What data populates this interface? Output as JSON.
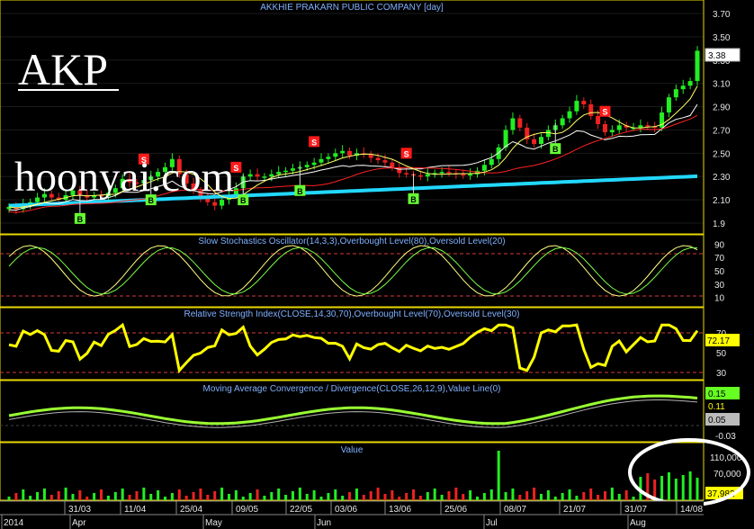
{
  "window": {
    "title": "AKKHIE PRAKARN PUBLIC COMPANY [day]",
    "ticker": "AKP",
    "watermark": "hoonyai.com"
  },
  "colors": {
    "background": "#000000",
    "up_candle": "#22ee22",
    "down_candle": "#ee2222",
    "ma_short": "#ffff66",
    "ma_mid": "#ff2222",
    "ma_long": "#ffffff",
    "ma_longest": "#22d8ff",
    "panel_border": "#e8d800",
    "header_text": "#7fb0ff",
    "sell_box": "#ff1a1a",
    "buy_box": "#66ff33",
    "macd_line": "#99ff33",
    "rsi_line": "#ffff00"
  },
  "chart_data": [
    {
      "type": "candlestick",
      "title": "AKKHIE PRAKARN PUBLIC COMPANY [day]",
      "y_ticks": [
        "3.70",
        "3.50",
        "3.30",
        "3.10",
        "2.90",
        "2.70",
        "2.50",
        "2.30",
        "2.10",
        "1.9"
      ],
      "ylim": [
        1.85,
        3.75
      ],
      "last_value_label": "3.38",
      "close": [
        2.04,
        2.02,
        2.06,
        2.08,
        2.12,
        2.15,
        2.12,
        2.1,
        2.14,
        2.18,
        2.14,
        2.12,
        2.14,
        2.13,
        2.16,
        2.2,
        2.28,
        2.25,
        2.24,
        2.27,
        2.3,
        2.34,
        2.38,
        2.45,
        2.32,
        2.24,
        2.18,
        2.12,
        2.08,
        2.05,
        2.1,
        2.14,
        2.2,
        2.3,
        2.32,
        2.3,
        2.3,
        2.32,
        2.34,
        2.35,
        2.37,
        2.38,
        2.4,
        2.42,
        2.45,
        2.47,
        2.5,
        2.52,
        2.48,
        2.5,
        2.49,
        2.46,
        2.44,
        2.42,
        2.38,
        2.33,
        2.32,
        2.31,
        2.3,
        2.32,
        2.33,
        2.34,
        2.33,
        2.32,
        2.31,
        2.32,
        2.35,
        2.4,
        2.45,
        2.55,
        2.7,
        2.8,
        2.72,
        2.62,
        2.58,
        2.64,
        2.7,
        2.74,
        2.8,
        2.86,
        2.95,
        2.92,
        2.82,
        2.75,
        2.68,
        2.7,
        2.74,
        2.72,
        2.72,
        2.74,
        2.73,
        2.72,
        2.85,
        2.98,
        3.05,
        3.08,
        3.12,
        3.38
      ],
      "signals": [
        {
          "label": "S",
          "index": 19
        },
        {
          "label": "S",
          "index": 32
        },
        {
          "label": "S",
          "index": 43
        },
        {
          "label": "S",
          "index": 56
        },
        {
          "label": "S",
          "index": 84
        },
        {
          "label": "B",
          "index": 10
        },
        {
          "label": "B",
          "index": 20
        },
        {
          "label": "B",
          "index": 33
        },
        {
          "label": "B",
          "index": 41
        },
        {
          "label": "B",
          "index": 57
        },
        {
          "label": "B",
          "index": 77
        }
      ]
    },
    {
      "type": "line",
      "title": "Slow Stochastics Oscillator(14,3,3),Overbought Level(80),Oversold Level(20)",
      "y_ticks": [
        "90",
        "70",
        "50",
        "30",
        "10"
      ],
      "ylim": [
        0,
        100
      ],
      "overbought": 80,
      "oversold": 20
    },
    {
      "type": "line",
      "title": "Relative Strength Index(CLOSE,14,30,70),Overbought Level(70),Oversold Level(30)",
      "y_ticks": [
        "70",
        "50",
        "30"
      ],
      "ylim": [
        20,
        90
      ],
      "last_value_label": "72.17",
      "overbought": 70,
      "oversold": 30
    },
    {
      "type": "line",
      "title": "Moving Average Convergence / Divergence(CLOSE,26,12,9),Value Line(0)",
      "y_ticks": [
        "0.15",
        "0.11",
        "0.05",
        "-0.03"
      ],
      "value_labels": [
        "0.15",
        "0.11",
        "0.05"
      ]
    },
    {
      "type": "bar",
      "title": "Value",
      "y_ticks": [
        "110,000",
        "70,000",
        "30,000"
      ],
      "last_value_label": "37,982"
    }
  ],
  "x_axis": {
    "day_labels": [
      "31/03",
      "11/04",
      "25/04",
      "09/05",
      "22/05",
      "03/06",
      "13/06",
      "25/06",
      "08/07",
      "21/07",
      "31/07",
      "14/08"
    ],
    "month_labels": [
      "2014",
      "Apr",
      "May",
      "Jun",
      "Jul",
      "Aug"
    ]
  }
}
